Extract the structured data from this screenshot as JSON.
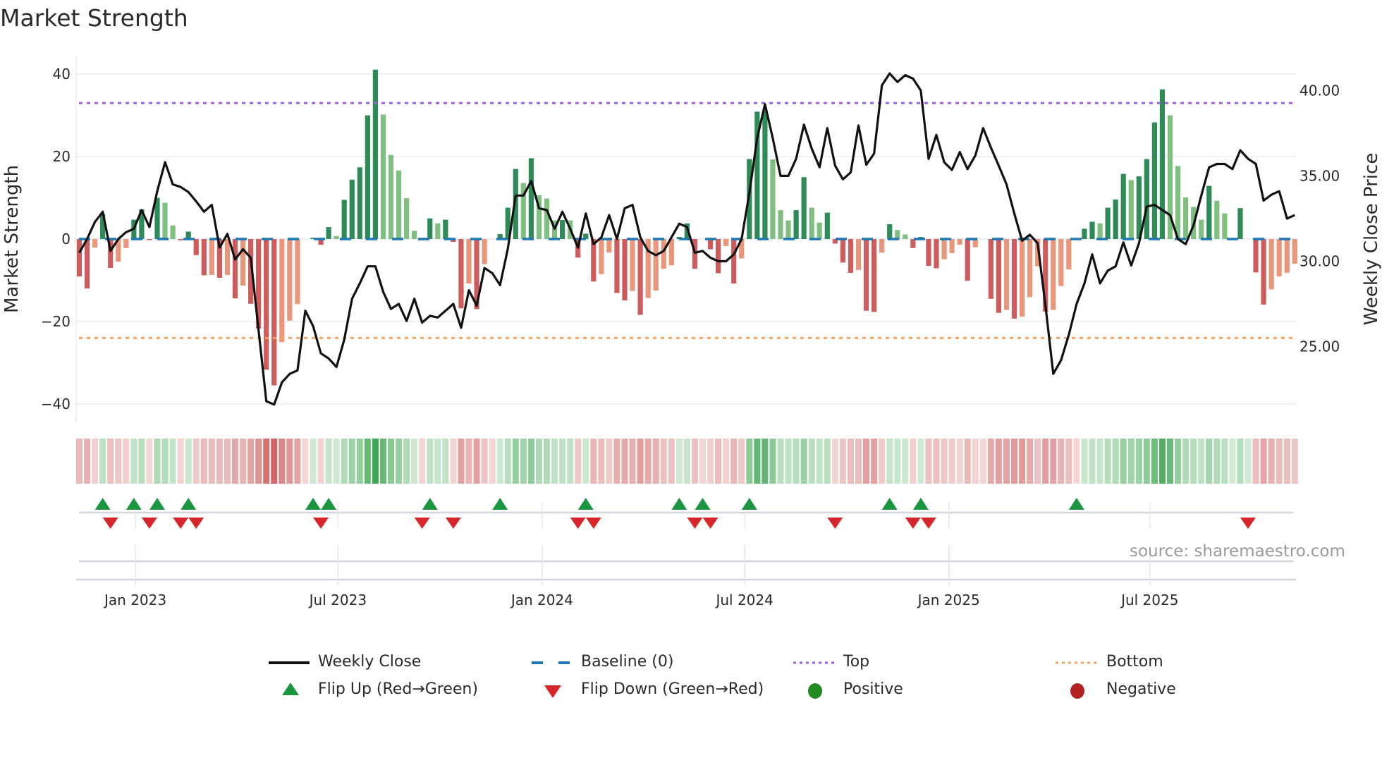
{
  "title": "Market Strength",
  "source": "source: sharemaestro.com",
  "legend": {
    "weekly_close": "Weekly Close",
    "baseline": "Baseline (0)",
    "top": "Top",
    "bottom": "Bottom",
    "flip_up": "Flip Up (Red→Green)",
    "flip_down": "Flip Down (Green→Red)",
    "positive": "Positive",
    "negative": "Negative"
  },
  "colors": {
    "green_dark": "#2e8b57",
    "green_light": "#7fbf7f",
    "red_dark": "#cd5c5c",
    "red_light": "#e9967a",
    "baseline": "#1f77b4",
    "top": "#9b5de5",
    "bottom": "#f4a460",
    "line": "#111111",
    "flip_up": "#1a9641",
    "flip_down": "#d7262b",
    "positive": "#228b22",
    "negative": "#b22222"
  },
  "chart_data": {
    "type": "bar",
    "title": "Market Strength",
    "ylabel": "Market Strength",
    "y2label": "Weekly Close Price",
    "ylim": [
      -44.3,
      44.3
    ],
    "y2lim": [
      20.6,
      42.0
    ],
    "yticks": [
      "40",
      "20",
      "0",
      "−20",
      "−40"
    ],
    "ytick_values": [
      40,
      20,
      0,
      -20,
      -40
    ],
    "y2ticks": [
      "40.00",
      "35.00",
      "30.00",
      "25.00"
    ],
    "y2tick_values": [
      40,
      35,
      30,
      25
    ],
    "xticks": [
      {
        "label": "Jan 2023",
        "week": 7.2
      },
      {
        "label": "Jul 2023",
        "week": 33.2
      },
      {
        "label": "Jan 2024",
        "week": 59.4
      },
      {
        "label": "Jul 2024",
        "week": 85.4
      },
      {
        "label": "Jan 2025",
        "week": 111.6
      },
      {
        "label": "Jul 2025",
        "week": 137.4
      }
    ],
    "top_level": 33,
    "bottom_level": -24,
    "baseline": 0,
    "strength": [
      -9.1,
      -12,
      -2.1,
      6,
      -7,
      -5.5,
      -2.2,
      4.7,
      7.2,
      -0.2,
      10,
      8.8,
      3.3,
      -0.3,
      1.8,
      -3.9,
      -8.8,
      -8.7,
      -9.4,
      -8.7,
      -14.4,
      -11.3,
      -15.7,
      -21.7,
      -31.7,
      -35.5,
      -25,
      -19.8,
      -15.8,
      0,
      0.3,
      -1.4,
      2.9,
      0.7,
      9.5,
      14.4,
      17.4,
      30,
      41.1,
      30.2,
      20.4,
      16.6,
      9.9,
      2,
      -0.3,
      5,
      3.8,
      4.7,
      -0.7,
      -16.8,
      -10.8,
      -17,
      -6.1,
      0,
      1.2,
      7.6,
      17,
      13.6,
      19.6,
      10.6,
      9.8,
      4.5,
      4.6,
      4.5,
      -4.5,
      1.3,
      -10.3,
      -8.5,
      -3.3,
      -13.1,
      -14.9,
      -12.6,
      -18.4,
      -14.3,
      -12.5,
      -7.2,
      -6.4,
      0.5,
      3.8,
      -7.2,
      0,
      -2.5,
      -8.3,
      -1.7,
      -10.8,
      -4.7,
      19.4,
      30.9,
      31.2,
      19.3,
      7,
      4.5,
      7,
      15,
      7.6,
      4,
      6.4,
      -1.1,
      -5.7,
      -8.2,
      -7.5,
      -17.4,
      -17.7,
      -3.3,
      3.6,
      2.2,
      1.1,
      -2.2,
      0.5,
      -6.5,
      -7.1,
      -4.9,
      -3.4,
      -1.4,
      -10.1,
      -2,
      0,
      -14.5,
      -17.9,
      -17.2,
      -19.3,
      -18.8,
      -14.1,
      -6.6,
      -17.6,
      -17.2,
      -11.4,
      -7.4,
      0,
      2.5,
      4.2,
      3.8,
      7.6,
      9.6,
      15.8,
      14.3,
      15.2,
      19.4,
      28.3,
      36.3,
      30,
      17.7,
      10.1,
      7.8,
      4.7,
      12.9,
      9.3,
      6.2,
      0,
      7.5,
      0,
      -8.1,
      -15.9,
      -12.2,
      -9.1,
      -8.2,
      -6.0
    ],
    "weekly_close": [
      30.5,
      31.3,
      32.3,
      32.9,
      30.6,
      31.3,
      31.7,
      31.9,
      33.0,
      32.0,
      34.1,
      35.8,
      34.5,
      34.35,
      34.05,
      33.5,
      32.9,
      33.3,
      30.8,
      31.6,
      30.1,
      30.7,
      30.2,
      26.0,
      21.8,
      21.6,
      22.9,
      23.4,
      23.6,
      27.1,
      26.2,
      24.6,
      24.3,
      23.8,
      25.4,
      27.8,
      28.7,
      29.7,
      29.7,
      28.2,
      27.2,
      27.5,
      26.5,
      27.8,
      26.4,
      26.8,
      26.7,
      27.1,
      27.5,
      26.1,
      28.3,
      27.4,
      29.6,
      29.3,
      28.6,
      30.75,
      33.85,
      33.85,
      34.7,
      33.1,
      33.0,
      31.9,
      32.9,
      31.9,
      30.8,
      32.8,
      31.0,
      31.4,
      32.7,
      31.3,
      33.1,
      33.3,
      31.4,
      30.6,
      30.35,
      30.6,
      31.4,
      32.2,
      32.0,
      30.5,
      30.6,
      30.2,
      30.0,
      30.0,
      30.4,
      31.3,
      34.0,
      37.2,
      39.2,
      37.2,
      35.0,
      35.0,
      36.0,
      38.0,
      36.6,
      35.5,
      37.8,
      35.6,
      34.8,
      35.2,
      37.95,
      35.65,
      36.3,
      40.3,
      41.0,
      40.5,
      40.9,
      40.7,
      40.0,
      36.0,
      37.4,
      35.8,
      35.35,
      36.4,
      35.4,
      36.2,
      37.8,
      36.65,
      35.6,
      34.5,
      32.8,
      31.2,
      31.55,
      31.05,
      27.4,
      23.4,
      24.2,
      25.7,
      27.5,
      28.7,
      30.4,
      28.7,
      29.45,
      29.7,
      31.1,
      29.75,
      31.05,
      33.2,
      33.3,
      33.0,
      32.7,
      31.3,
      31.0,
      32.1,
      33.85,
      35.5,
      35.7,
      35.7,
      35.4,
      36.5,
      36.0,
      35.7,
      33.55,
      33.9,
      34.1,
      32.5,
      32.7
    ],
    "flip_up_weeks": [
      3,
      7,
      10,
      14,
      30,
      32,
      45,
      54,
      65,
      77,
      80,
      86,
      104,
      108,
      128
    ],
    "flip_down_weeks": [
      4,
      9,
      13,
      15,
      31,
      44,
      48,
      64,
      66,
      79,
      81,
      97,
      107,
      109,
      150
    ],
    "legend_position": "bottom"
  }
}
